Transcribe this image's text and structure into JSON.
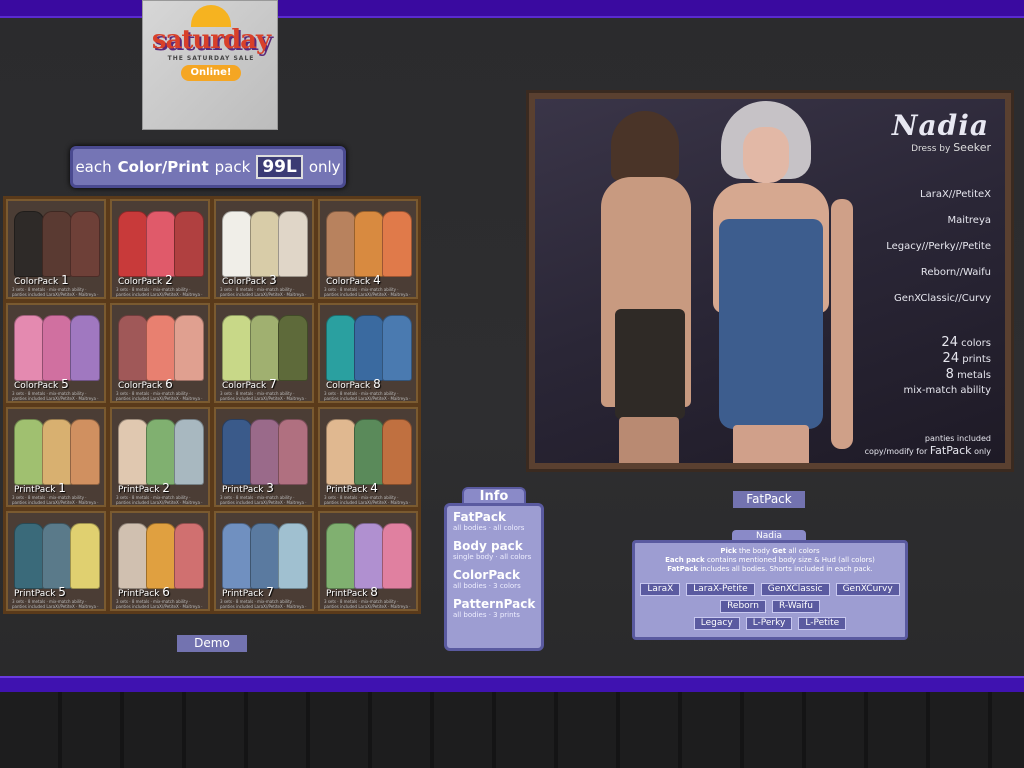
{
  "poster": {
    "title": "saturday",
    "subtitle": "THE SATURDAY SALE",
    "badge": "Online!"
  },
  "price_banner": {
    "prefix": "each",
    "highlight": "Color/Print",
    "middle": "pack",
    "price": "99L",
    "suffix": "only"
  },
  "grid": {
    "tiles": [
      {
        "label": "ColorPack",
        "num": "1",
        "colors": [
          "#2e2a28",
          "#5a3a32",
          "#6e4038"
        ]
      },
      {
        "label": "ColorPack",
        "num": "2",
        "colors": [
          "#c83a3a",
          "#e05a6a",
          "#b04040"
        ]
      },
      {
        "label": "ColorPack",
        "num": "3",
        "colors": [
          "#f0eee8",
          "#d8cca8",
          "#e0d6c8"
        ]
      },
      {
        "label": "ColorPack",
        "num": "4",
        "colors": [
          "#b8825e",
          "#d88a40",
          "#e07a4a"
        ]
      },
      {
        "label": "ColorPack",
        "num": "5",
        "colors": [
          "#e48ab0",
          "#d070a0",
          "#a078c0"
        ]
      },
      {
        "label": "ColorPack",
        "num": "6",
        "colors": [
          "#a05858",
          "#e88070",
          "#e0a090"
        ]
      },
      {
        "label": "ColorPack",
        "num": "7",
        "colors": [
          "#c8d888",
          "#a0b070",
          "#5e6a3a"
        ]
      },
      {
        "label": "ColorPack",
        "num": "8",
        "colors": [
          "#2aa0a0",
          "#3a6aa0",
          "#4a7ab0"
        ]
      },
      {
        "label": "PrintPack",
        "num": "1",
        "colors": [
          "#a0c070",
          "#d8b070",
          "#d09060"
        ]
      },
      {
        "label": "PrintPack",
        "num": "2",
        "colors": [
          "#e0c8b0",
          "#80b070",
          "#a8b8c0"
        ]
      },
      {
        "label": "PrintPack",
        "num": "3",
        "colors": [
          "#3a5a8a",
          "#9a6a8a",
          "#b07080"
        ]
      },
      {
        "label": "PrintPack",
        "num": "4",
        "colors": [
          "#e0b890",
          "#5a8a5a",
          "#c07040"
        ]
      },
      {
        "label": "PrintPack",
        "num": "5",
        "colors": [
          "#3a6a7a",
          "#5a7a8a",
          "#e0d070"
        ]
      },
      {
        "label": "PrintPack",
        "num": "6",
        "colors": [
          "#d0c0b0",
          "#e0a040",
          "#d07070"
        ]
      },
      {
        "label": "PrintPack",
        "num": "7",
        "colors": [
          "#7090c0",
          "#5a7aa0",
          "#a0c0d0"
        ]
      },
      {
        "label": "PrintPack",
        "num": "8",
        "colors": [
          "#80b070",
          "#b090d0",
          "#e080a0"
        ]
      }
    ],
    "fine_print": "3 sets · 8 metals · mix-match ability · panties included\nLaraX//PetiteX · Maitreya · Legacy//Perky//Petite\nReborn//Waifu · GenXClassic//Curvy"
  },
  "demo_label": "Demo",
  "ad": {
    "title": "Nadia",
    "byline_prefix": "Dress by",
    "brand": "Seeker",
    "bodies": [
      "LaraX//PetiteX",
      "Maitreya",
      "Legacy//Perky//Petite",
      "Reborn//Waifu",
      "GenXClassic//Curvy"
    ],
    "stats": [
      {
        "num": "24",
        "text": "colors"
      },
      {
        "num": "24",
        "text": "prints"
      },
      {
        "num": "8",
        "text": "metals"
      }
    ],
    "mix_match": "mix-match ability",
    "panties": "panties included",
    "copy_prefix": "copy/modify for",
    "copy_highlight": "FatPack",
    "copy_suffix": "only"
  },
  "fatpack_label": "FatPack",
  "info": {
    "tab": "Info",
    "items": [
      {
        "title": "FatPack",
        "sub": "all bodies · all colors"
      },
      {
        "title": "Body pack",
        "sub": "single body · all colors"
      },
      {
        "title": "ColorPack",
        "sub": "all bodies · 3 colors"
      },
      {
        "title": "PatternPack",
        "sub": "all bodies · 3 prints"
      }
    ]
  },
  "nadia": {
    "tab": "Nadia",
    "line1_b1": "Pick",
    "line1_t1": "the body",
    "line1_b2": "Get",
    "line1_t2": "all colors",
    "line2_b": "Each pack",
    "line2_t": "contains mentioned body size & Hud (all colors)",
    "line3_b": "FatPack",
    "line3_t": "includes all bodies. Shorts included in each pack.",
    "row1": [
      "LaraX",
      "LaraX-Petite",
      "GenXClassic",
      "GenXCurvy"
    ],
    "row2": [
      "Reborn",
      "R-Waifu"
    ],
    "row3": [
      "Legacy",
      "L-Perky",
      "L-Petite"
    ]
  }
}
